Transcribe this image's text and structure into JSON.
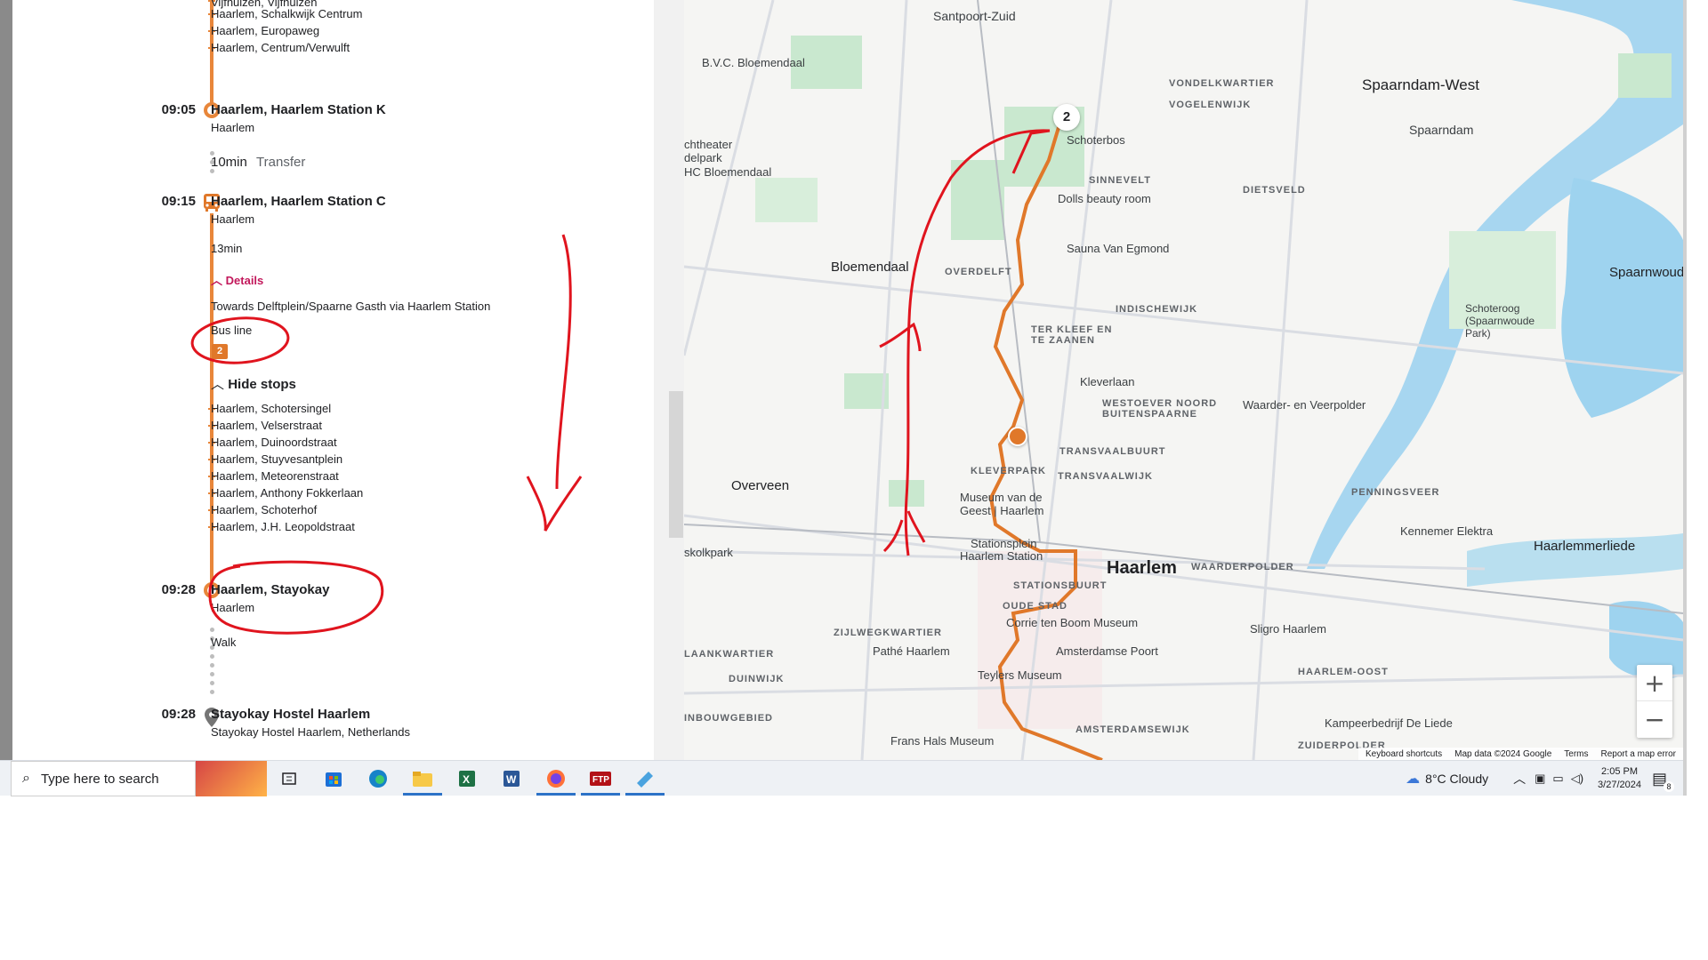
{
  "itinerary": {
    "top_stops": [
      "Vijfhuizen, Vijfhuizen",
      "Haarlem, Schalkwijk Centrum",
      "Haarlem, Europaweg",
      "Haarlem, Centrum/Verwulft"
    ],
    "stop1": {
      "time": "09:05",
      "name": "Haarlem, Haarlem Station K",
      "city": "Haarlem"
    },
    "transfer": {
      "duration": "10min",
      "label": "Transfer"
    },
    "stop2": {
      "time": "09:15",
      "name": "Haarlem, Haarlem Station C",
      "city": "Haarlem"
    },
    "ride_duration": "13min",
    "details_label": "Details",
    "towards": "Towards Delftplein/Spaarne Gasth via Haarlem Station",
    "bus_line_label": "Bus line",
    "bus_line_number": "2",
    "hide_stops_label": "Hide stops",
    "intermediate_stops": [
      "Haarlem, Schotersingel",
      "Haarlem, Velserstraat",
      "Haarlem, Duinoordstraat",
      "Haarlem, Stuyvesantplein",
      "Haarlem, Meteorenstraat",
      "Haarlem, Anthony Fokkerlaan",
      "Haarlem, Schoterhof",
      "Haarlem, J.H. Leopoldstraat"
    ],
    "stop3": {
      "time": "09:28",
      "name": "Haarlem, Stayokay",
      "city": "Haarlem"
    },
    "walk_label": "Walk",
    "destination": {
      "time": "09:28",
      "name": "Stayokay Hostel Haarlem",
      "address": "Stayokay Hostel Haarlem, Netherlands"
    }
  },
  "map": {
    "labels": {
      "santpoort_zuid": "Santpoort-Zuid",
      "bvc": "B.V.C. Bloemendaal",
      "theater": "chtheater",
      "delpark": "delpark",
      "hc": "HC Bloemendaal",
      "vondelkwartier": "VONDELKWARTIER",
      "vogelenwijk": "VOGELENWIJK",
      "spaarndam_west": "Spaarndam-West",
      "spaarndam": "Spaarndam",
      "schoterbos": "Schoterbos",
      "sinnevelt": "SINNEVELT",
      "dolls": "Dolls beauty room",
      "dietsveld": "DIETSVELD",
      "bloemendaal": "Bloemendaal",
      "overdelft": "OVERDELFT",
      "sauna": "Sauna Van Egmond",
      "indischewijk": "INDISCHEWIJK",
      "spaarnwoude": "Spaarnwoude",
      "schoteroog": "Schoteroog (Spaarnwoude Park)",
      "ter_kleef": "TER KLEEF EN TE ZAANEN",
      "kleverlaan": "Kleverlaan",
      "westoever": "WESTOEVER NOORD BUITENSPAARNE",
      "waarder": "Waarder- en Veerpolder",
      "transvaalbuurt": "TRANSVAALBUURT",
      "transvaalwijk": "TRANSVAALWIJK",
      "kleverpark": "KLEVERPARK",
      "overveen": "Overveen",
      "museum_geest": "Museum van de Geest | Haarlem",
      "penningsveer": "PENNINGSVEER",
      "kennemer": "Kennemer Elektra",
      "haarlemmerliede": "Haarlemmerliede",
      "skolkpark": "skolkpark",
      "stationsplein": "Stationsplein",
      "haarlem_station": "Haarlem Station",
      "haarlem": "Haarlem",
      "waarderpolder": "WAARDERPOLDER",
      "stationsbuurt": "STATIONSBUURT",
      "oude_stad": "OUDE STAD",
      "corrie": "Corrie ten Boom Museum",
      "sligro": "Sligro Haarlem",
      "zijlweg": "ZIJLWEGKWARTIER",
      "laankwartier": "LAANKWARTIER",
      "pathe": "Pathé Haarlem",
      "amsterdamse_poort": "Amsterdamse Poort",
      "haarlem_oost": "HAARLEM-OOST",
      "duinwijk": "DUINWIJK",
      "teylers": "Teylers Museum",
      "inbouwgebied": "INBOUWGEBIED",
      "amsterdamsewijk": "AMSTERDAMSEWIJK",
      "kampeerbedrijf": "Kampeerbedrijf De Liede",
      "frans_hals": "Frans Hals Museum",
      "zuiderpolder": "ZUIDERPOLDER",
      "route_marker": "2"
    },
    "footer": {
      "shortcuts": "Keyboard shortcuts",
      "map_data": "Map data ©2024 Google",
      "terms": "Terms",
      "report": "Report a map error"
    },
    "zoom_in": "+",
    "zoom_out": "−",
    "route_color": "#e0782a",
    "annotation_color": "#e0141e"
  },
  "taskbar": {
    "search_placeholder": "Type here to search",
    "weather": "8°C  Cloudy",
    "time": "2:05 PM",
    "date": "3/27/2024",
    "notification_count": "8"
  }
}
